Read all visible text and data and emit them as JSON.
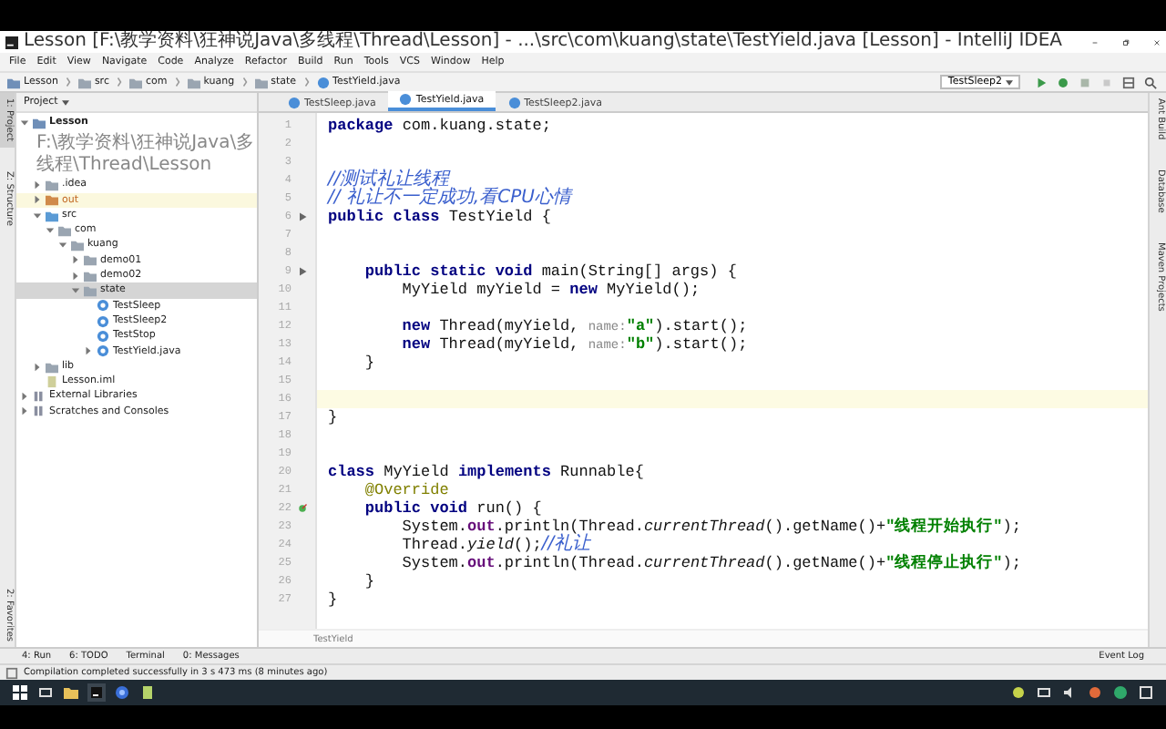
{
  "window": {
    "title": "Lesson [F:\\教学资料\\狂神说Java\\多线程\\Thread\\Lesson] - ...\\src\\com\\kuang\\state\\TestYield.java [Lesson] - IntelliJ IDEA"
  },
  "menu": [
    "File",
    "Edit",
    "View",
    "Navigate",
    "Code",
    "Analyze",
    "Refactor",
    "Build",
    "Run",
    "Tools",
    "VCS",
    "Window",
    "Help"
  ],
  "breadcrumbs": [
    {
      "label": "Lesson",
      "kind": "module"
    },
    {
      "label": "src",
      "kind": "folder"
    },
    {
      "label": "com",
      "kind": "folder"
    },
    {
      "label": "kuang",
      "kind": "folder"
    },
    {
      "label": "state",
      "kind": "folder"
    },
    {
      "label": "TestYield.java",
      "kind": "class"
    }
  ],
  "run_config": "TestSleep2",
  "project_panel": {
    "title": "Project",
    "tree": [
      {
        "label": "Lesson",
        "path": "F:\\教学资料\\狂神说Java\\多线程\\Thread\\Lesson",
        "kind": "module",
        "expanded": true,
        "selected": false,
        "children": [
          {
            "label": ".idea",
            "kind": "folder",
            "expanded": false,
            "selected": false
          },
          {
            "label": "out",
            "kind": "out",
            "expanded": false,
            "selected": false
          },
          {
            "label": "src",
            "kind": "src",
            "expanded": true,
            "selected": false,
            "children": [
              {
                "label": "com",
                "kind": "package",
                "expanded": true,
                "selected": false,
                "children": [
                  {
                    "label": "kuang",
                    "kind": "package",
                    "expanded": true,
                    "selected": false,
                    "children": [
                      {
                        "label": "demo01",
                        "kind": "package",
                        "expanded": false,
                        "selected": false
                      },
                      {
                        "label": "demo02",
                        "kind": "package",
                        "expanded": false,
                        "selected": false
                      },
                      {
                        "label": "state",
                        "kind": "package",
                        "expanded": true,
                        "selected": true,
                        "children": [
                          {
                            "label": "TestSleep",
                            "kind": "class",
                            "selected": false
                          },
                          {
                            "label": "TestSleep2",
                            "kind": "class",
                            "selected": false
                          },
                          {
                            "label": "TestStop",
                            "kind": "class",
                            "selected": false
                          },
                          {
                            "label": "TestYield.java",
                            "kind": "class",
                            "expanded": false,
                            "selected": false
                          }
                        ]
                      }
                    ]
                  }
                ]
              }
            ]
          },
          {
            "label": "lib",
            "kind": "folder",
            "expanded": false,
            "selected": false
          },
          {
            "label": "Lesson.iml",
            "kind": "file",
            "selected": false
          }
        ]
      },
      {
        "label": "External Libraries",
        "kind": "library",
        "expanded": false,
        "selected": false
      },
      {
        "label": "Scratches and Consoles",
        "kind": "scratch",
        "expanded": false,
        "selected": false
      }
    ]
  },
  "left_strip": [
    {
      "label": "1: Project",
      "selected": true
    },
    {
      "label": "Z: Structure",
      "selected": false
    },
    {
      "label": "2: Favorites",
      "selected": false
    }
  ],
  "right_strip": [
    "Ant Build",
    "Database",
    "Maven Projects"
  ],
  "editor_tabs": [
    {
      "label": "TestSleep.java",
      "selected": false
    },
    {
      "label": "TestYield.java",
      "selected": true
    },
    {
      "label": "TestSleep2.java",
      "selected": false
    }
  ],
  "code": [
    {
      "number": "1",
      "kind": "plain",
      "segments": [
        {
          "kind": "kw",
          "text": "package"
        },
        {
          "kind": "plain",
          "text": " com.kuang.state;"
        }
      ]
    },
    {
      "number": "2",
      "kind": "plain"
    },
    {
      "number": "3",
      "kind": "plain"
    },
    {
      "number": "4",
      "kind": "plain",
      "segments": [
        {
          "kind": "comment",
          "text": "//测试礼让线程"
        }
      ]
    },
    {
      "number": "5",
      "kind": "plain",
      "segments": [
        {
          "kind": "comment",
          "text": "// 礼让不一定成功,看CPU心情"
        }
      ]
    },
    {
      "number": "6",
      "kind": "run",
      "segments": [
        {
          "kind": "kw",
          "text": "public class"
        },
        {
          "kind": "plain",
          "text": " TestYield {"
        }
      ]
    },
    {
      "number": "7",
      "kind": "plain"
    },
    {
      "number": "8",
      "kind": "plain"
    },
    {
      "number": "9",
      "kind": "run",
      "segments": [
        {
          "kind": "kw",
          "text": "    public static void"
        },
        {
          "kind": "plain",
          "text": " main(String[] args) {"
        }
      ]
    },
    {
      "number": "10",
      "kind": "plain",
      "segments": [
        {
          "kind": "plain",
          "text": "        MyYield myYield = "
        },
        {
          "kind": "kw",
          "text": "new"
        },
        {
          "kind": "plain",
          "text": " MyYield();"
        }
      ]
    },
    {
      "number": "11",
      "kind": "plain"
    },
    {
      "number": "12",
      "kind": "plain",
      "segments": [
        {
          "kind": "kw",
          "text": "        new"
        },
        {
          "kind": "plain",
          "text": " Thread(myYield, "
        },
        {
          "kind": "hint",
          "text": "name:"
        },
        {
          "kind": "str",
          "text": "\"a\""
        },
        {
          "kind": "plain",
          "text": ").start();"
        }
      ]
    },
    {
      "number": "13",
      "kind": "plain",
      "segments": [
        {
          "kind": "kw",
          "text": "        new"
        },
        {
          "kind": "plain",
          "text": " Thread(myYield, "
        },
        {
          "kind": "hint",
          "text": "name:"
        },
        {
          "kind": "str",
          "text": "\"b\""
        },
        {
          "kind": "plain",
          "text": ").start();"
        }
      ]
    },
    {
      "number": "14",
      "kind": "plain",
      "segments": [
        {
          "kind": "plain",
          "text": "    }"
        }
      ]
    },
    {
      "number": "15",
      "kind": "plain"
    },
    {
      "number": "16",
      "kind": "plain",
      "current": true
    },
    {
      "number": "17",
      "kind": "plain",
      "segments": [
        {
          "kind": "plain",
          "text": "}"
        }
      ]
    },
    {
      "number": "18",
      "kind": "plain"
    },
    {
      "number": "19",
      "kind": "plain"
    },
    {
      "number": "20",
      "kind": "plain",
      "segments": [
        {
          "kind": "kw",
          "text": "class"
        },
        {
          "kind": "plain",
          "text": " MyYield "
        },
        {
          "kind": "kw",
          "text": "implements"
        },
        {
          "kind": "plain",
          "text": " Runnable{"
        }
      ]
    },
    {
      "number": "21",
      "kind": "plain",
      "segments": [
        {
          "kind": "ann",
          "text": "    @Override"
        }
      ]
    },
    {
      "number": "22",
      "kind": "implements",
      "segments": [
        {
          "kind": "kw",
          "text": "    public void"
        },
        {
          "kind": "plain",
          "text": " run() {"
        }
      ]
    },
    {
      "number": "23",
      "kind": "plain",
      "segments": [
        {
          "kind": "plain",
          "text": "        System."
        },
        {
          "kind": "field",
          "text": "out"
        },
        {
          "kind": "plain",
          "text": ".println(Thread."
        },
        {
          "kind": "italic",
          "text": "currentThread"
        },
        {
          "kind": "plain",
          "text": "().getName()+"
        },
        {
          "kind": "str",
          "text": "\"线程开始执行\""
        },
        {
          "kind": "plain",
          "text": ");"
        }
      ]
    },
    {
      "number": "24",
      "kind": "plain",
      "segments": [
        {
          "kind": "plain",
          "text": "        Thread."
        },
        {
          "kind": "italic",
          "text": "yield"
        },
        {
          "kind": "plain",
          "text": "();"
        },
        {
          "kind": "comment",
          "text": "//礼让"
        }
      ]
    },
    {
      "number": "25",
      "kind": "plain",
      "segments": [
        {
          "kind": "plain",
          "text": "        System."
        },
        {
          "kind": "field",
          "text": "out"
        },
        {
          "kind": "plain",
          "text": ".println(Thread."
        },
        {
          "kind": "italic",
          "text": "currentThread"
        },
        {
          "kind": "plain",
          "text": "().getName()+"
        },
        {
          "kind": "str",
          "text": "\"线程停止执行\""
        },
        {
          "kind": "plain",
          "text": ");"
        }
      ]
    },
    {
      "number": "26",
      "kind": "plain",
      "segments": [
        {
          "kind": "plain",
          "text": "    }"
        }
      ]
    },
    {
      "number": "27",
      "kind": "plain",
      "segments": [
        {
          "kind": "plain",
          "text": "}"
        }
      ]
    }
  ],
  "editor_breadcrumb": "TestYield",
  "tool_windows": [
    "4: Run",
    "6: TODO",
    "Terminal",
    "0: Messages"
  ],
  "event_log": "Event Log",
  "status": "Compilation completed successfully in 3 s 473 ms (8 minutes ago)"
}
